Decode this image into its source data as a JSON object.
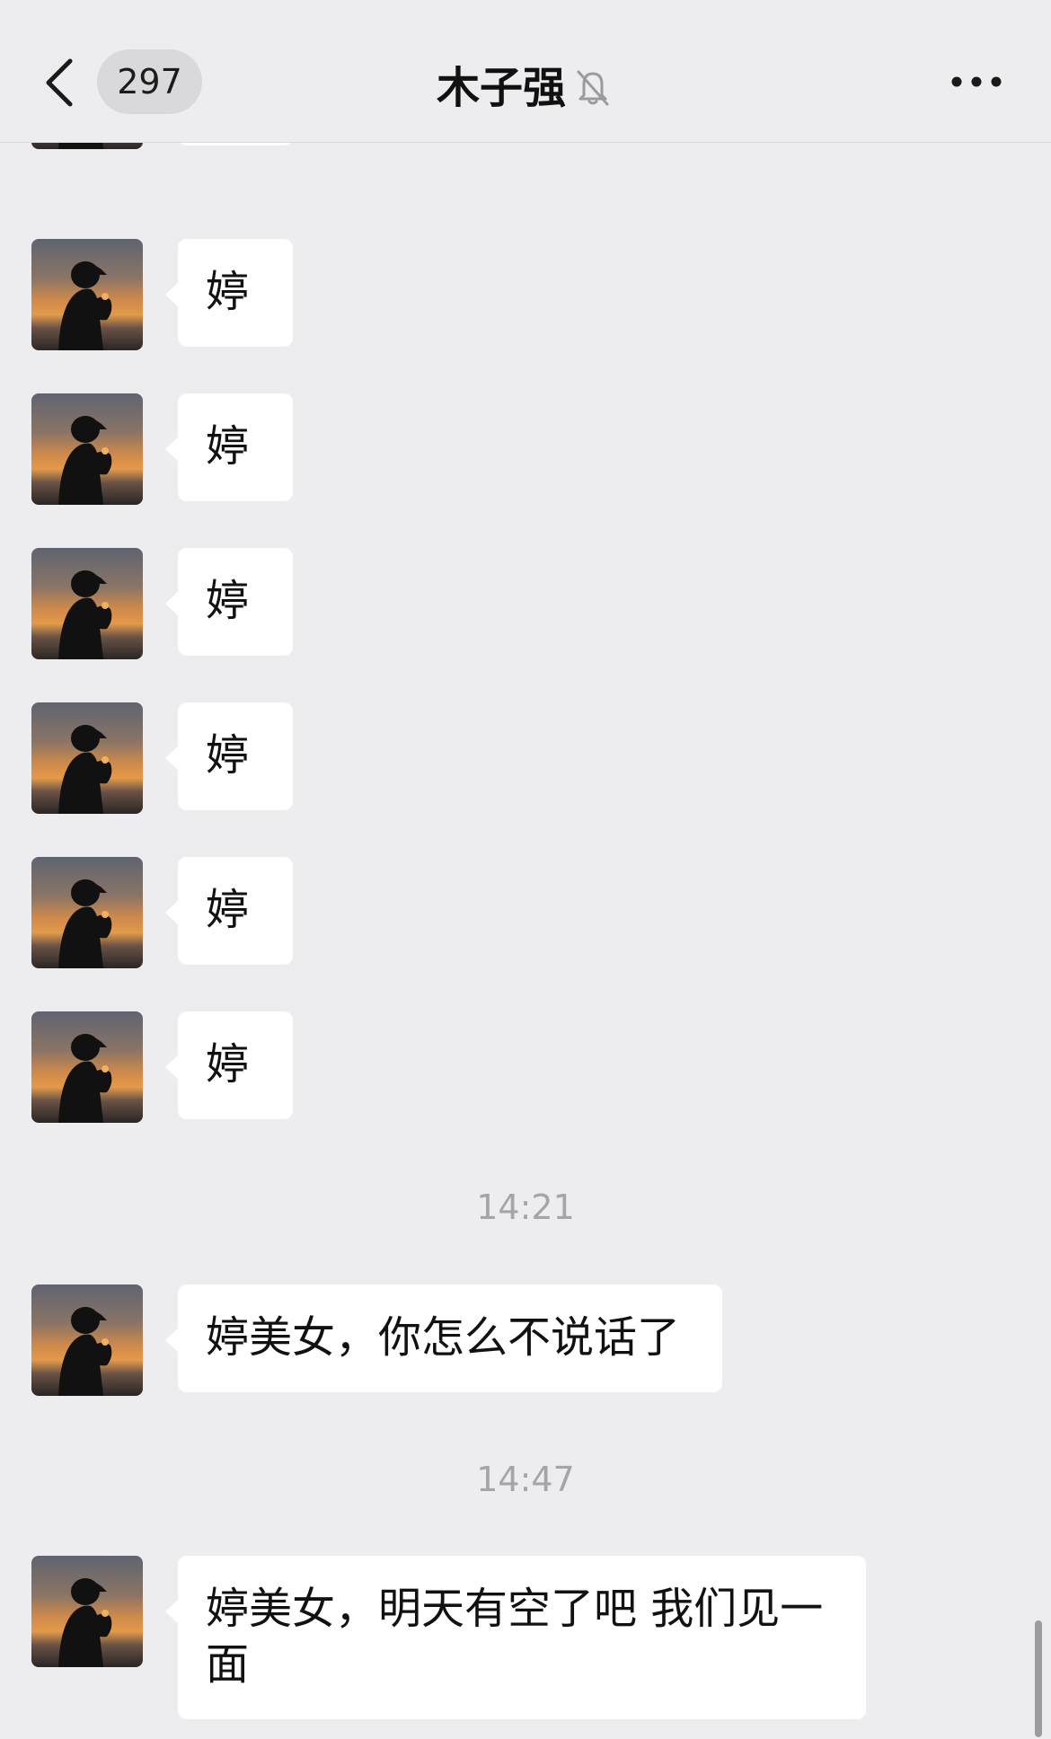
{
  "header": {
    "unread_count": "297",
    "title": "木子强",
    "back_icon": "chevron-left-icon",
    "mute_icon": "bell-off-icon",
    "more_icon": "more-dots-icon"
  },
  "messages": [
    {
      "type": "text",
      "text": "婷"
    },
    {
      "type": "text",
      "text": "婷"
    },
    {
      "type": "text",
      "text": "婷"
    },
    {
      "type": "text",
      "text": "婷"
    },
    {
      "type": "text",
      "text": "婷"
    },
    {
      "type": "text",
      "text": "婷"
    },
    {
      "type": "text",
      "text": "婷"
    },
    {
      "type": "time",
      "text": "14:21"
    },
    {
      "type": "text",
      "text": "婷美女，你怎么不说话了"
    },
    {
      "type": "time",
      "text": "14:47"
    },
    {
      "type": "text",
      "text": "婷美女，明天有空了吧 我们见一面"
    }
  ],
  "colors": {
    "background": "#ededf0",
    "bubble": "#ffffff",
    "timestamp": "#a5a5a8"
  }
}
